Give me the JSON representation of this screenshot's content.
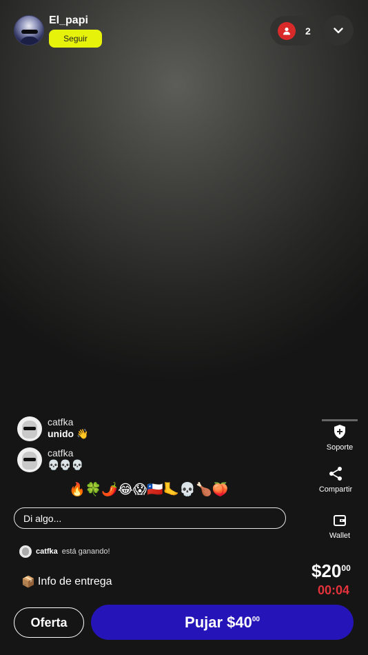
{
  "host": {
    "name": "El_papi",
    "follow_label": "Seguir"
  },
  "viewers": {
    "count": "2"
  },
  "chat": [
    {
      "user": "catfka",
      "text": "unido 👋"
    },
    {
      "user": "catfka",
      "text": "💀💀💀"
    }
  ],
  "reactions": "🔥🍀🌶️😂😱🇨🇱🦶💀🍗🍑",
  "input": {
    "placeholder": "Di algo..."
  },
  "winning": {
    "user": "catfka",
    "text": "está ganando!"
  },
  "delivery": {
    "icon": "📦",
    "label": "Info de entrega"
  },
  "side_actions": {
    "support": "Soporte",
    "share": "Compartir",
    "wallet": "Wallet"
  },
  "price": {
    "main": "$20",
    "cents": "00"
  },
  "timer": "00:04",
  "buttons": {
    "offer": "Oferta",
    "bid_main": "Pujar $40",
    "bid_cents": "00"
  },
  "colors": {
    "follow": "#e6f20a",
    "bid": "#2515b8",
    "timer": "#e4333b",
    "viewers_badge": "#d92a2a"
  }
}
